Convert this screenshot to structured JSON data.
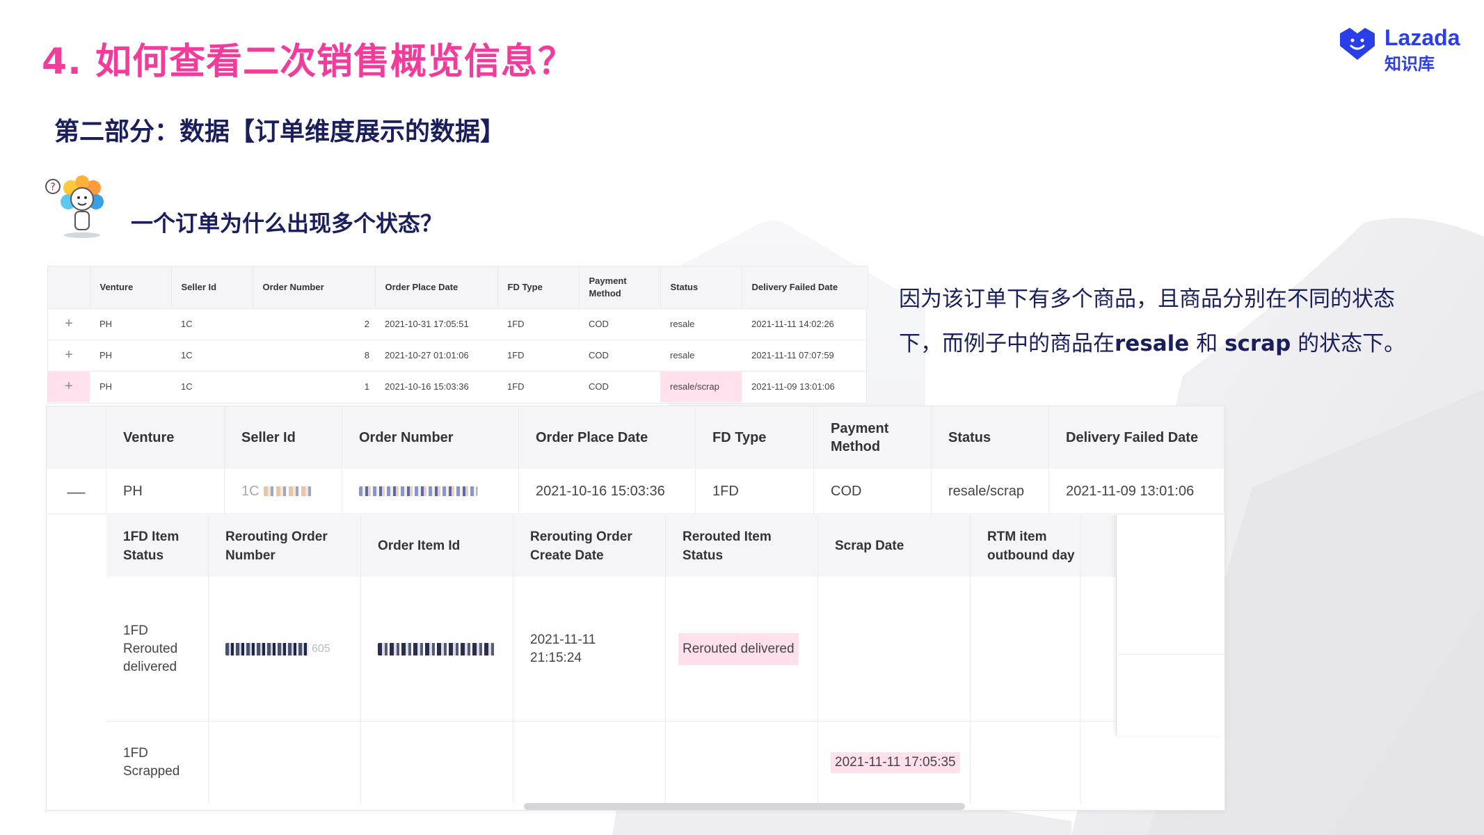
{
  "header": {
    "title": "4. 如何查看二次销售概览信息？",
    "section": "第二部分：数据【订单维度展示的数据】",
    "question": "一个订单为什么出现多个状态？"
  },
  "logo": {
    "name": "Lazada",
    "sub": "知识库",
    "color": "#2a3ee8"
  },
  "explanation": {
    "line1": "因为该订单下有多个商品，且商品分别在不同的状态",
    "line2_a": "下，而例子中的商品在",
    "line2_b": "resale",
    "line2_c": " 和 ",
    "line2_d": "scrap",
    "line2_e": " 的状态下。"
  },
  "small_table": {
    "headers": [
      "",
      "Venture",
      "Seller Id",
      "Order Number",
      "Order Place Date",
      "FD Type",
      "Payment Method",
      "Status",
      "Delivery Failed Date"
    ],
    "rows": [
      {
        "expand": "+",
        "venture": "PH",
        "seller": "1C",
        "order": "2",
        "date": "2021-10-31 17:05:51",
        "fd": "1FD",
        "payment": "COD",
        "status": "resale",
        "failed": "2021-11-11 14:02:26"
      },
      {
        "expand": "+",
        "venture": "PH",
        "seller": "1C",
        "order": "8",
        "date": "2021-10-27 01:01:06",
        "fd": "1FD",
        "payment": "COD",
        "status": "resale",
        "failed": "2021-11-11 07:07:59"
      },
      {
        "expand": "+",
        "venture": "PH",
        "seller": "1C",
        "order": "1",
        "date": "2021-10-16 15:03:36",
        "fd": "1FD",
        "payment": "COD",
        "status": "resale/scrap",
        "failed": "2021-11-09 13:01:06"
      }
    ]
  },
  "big_table": {
    "headers": [
      "",
      "Venture",
      "Seller Id",
      "Order Number",
      "Order Place Date",
      "FD Type",
      "Payment Method",
      "Status",
      "Delivery Failed Date"
    ],
    "row": {
      "expand": "—",
      "venture": "PH",
      "seller": "1C",
      "date": "2021-10-16 15:03:36",
      "fd": "1FD",
      "payment": "COD",
      "status": "resale/scrap",
      "failed": "2021-11-09 13:01:06"
    },
    "sub_headers": [
      "1FD Item Status",
      "Rerouting Order Number",
      "Order Item Id",
      "Rerouting Order Create Date",
      "Rerouted Item Status",
      "Scrap Date",
      "RTM item outbound day"
    ],
    "sub_rows": [
      {
        "status": "1FD Rerouted delivered",
        "reroute_no_tail": "605",
        "create_date": "2021-11-11 21:15:24",
        "rerouted_status": "Rerouted delivered",
        "scrap_date": ""
      },
      {
        "status": "1FD Scrapped",
        "reroute_no_tail": "",
        "create_date": "",
        "rerouted_status": "",
        "scrap_date": "2021-11-11 17:05:35"
      }
    ]
  },
  "colors": {
    "title": "#f23c9b",
    "navy": "#1a1f5c",
    "highlight": "#ffe0ec"
  }
}
